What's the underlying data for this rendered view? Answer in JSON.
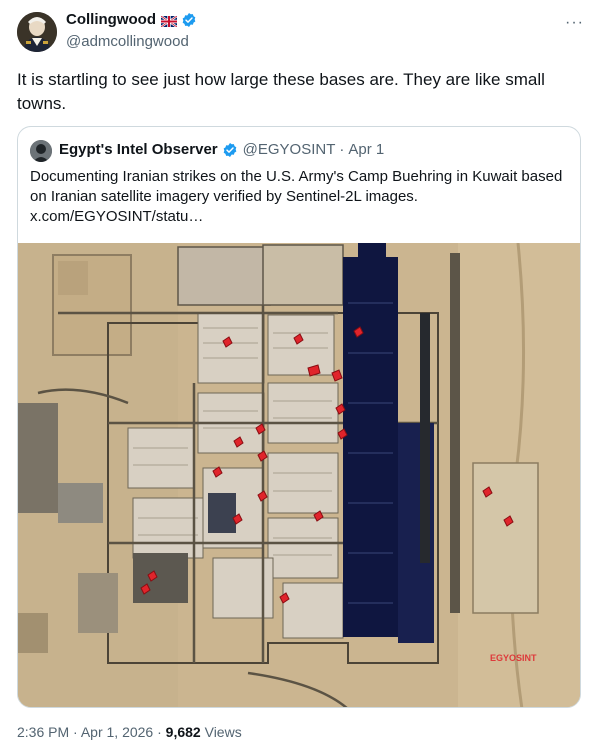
{
  "author": {
    "name": "Collingwood",
    "handle": "@admcollingwood",
    "flag_icon": "uk-flag-icon",
    "verified_icon": "verified-badge-icon"
  },
  "tweet_text": "It is startling to see just how large these bases are. They are like small towns.",
  "quoted": {
    "name": "Egypt's Intel Observer",
    "handle": "@EGYOSINT",
    "separator": "·",
    "date": "Apr 1",
    "text": "Documenting Iranian strikes on the U.S. Army's Camp Buehring in Kuwait based on Iranian satellite imagery verified by Sentinel-2L images.  x.com/EGYOSINT/statu…",
    "image_watermark": "EGYOSINT"
  },
  "meta": {
    "time": "2:36 PM",
    "separator1": "·",
    "date": "Apr 1, 2026",
    "separator2": "·",
    "views_count": "9,682",
    "views_label": "Views"
  },
  "more_label": "···",
  "colors": {
    "verified_blue": "#1d9bf0",
    "secondary_text": "#536471",
    "border": "#cfd9de",
    "strike_marker": "#e0242b",
    "runway": "#0f1640"
  }
}
